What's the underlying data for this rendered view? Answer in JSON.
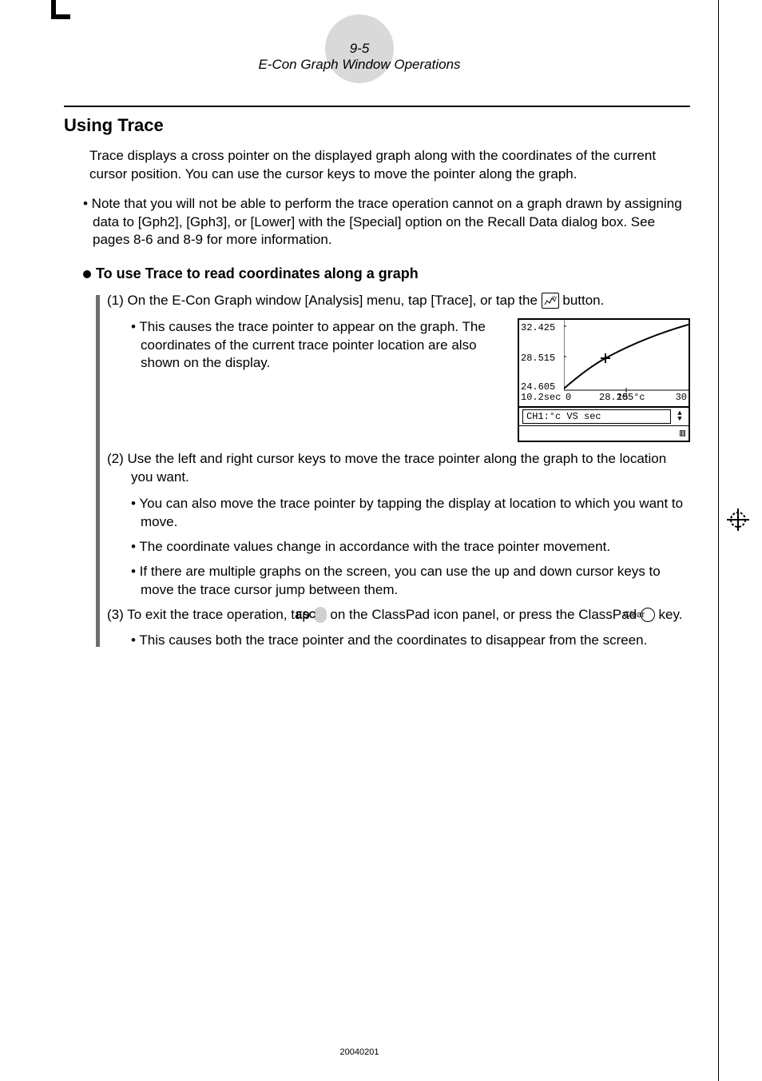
{
  "header": {
    "page_num": "9-5",
    "section_title": "E-Con Graph Window Operations"
  },
  "h2": "Using Trace",
  "intro": "Trace displays a cross pointer on the displayed graph along with the coordinates of the current cursor position. You can use the cursor keys to move the pointer along the graph.",
  "note": "• Note that you will not be able to perform the trace operation cannot on a graph drawn by assigning data to [Gph2], [Gph3], or [Lower] with the [Special] option on the Recall Data dialog box. See pages 8-6 and 8-9 for more information.",
  "sub_h": "To use Trace to read coordinates along a graph",
  "step1_prefix": "(1) On the E-Con Graph window [Analysis] menu, tap [Trace], or tap the ",
  "step1_suffix": " button.",
  "step1_bullet": "• This causes the trace pointer to appear on the graph. The coordinates of the current trace pointer location are also shown on the display.",
  "step2": "(2) Use the left and right cursor keys to move the trace pointer along the graph to the location you want.",
  "step2_b1": "• You can also move the trace pointer by tapping the display at location to which you want to move.",
  "step2_b2": "• The coordinate values change in accordance with the trace pointer movement.",
  "step2_b3": "• If there are multiple graphs on the screen, you can use the up and down cursor keys to move the trace cursor jump between them.",
  "step3_prefix": "(3) To exit the trace operation, tap ",
  "step3_mid": " on the ClassPad icon panel, or press the ClassPad ",
  "step3_suffix": " key.",
  "step3_b1": "• This causes both the trace pointer and the coordinates to disappear from the screen.",
  "icons": {
    "trace_btn": "⤳",
    "esc_label": "ESC",
    "clear_label": "Clear"
  },
  "figure": {
    "y_ticks": [
      "32.425",
      "28.515",
      "24.605"
    ],
    "x_ticks": [
      "0",
      "15",
      "30"
    ],
    "cursor_x": "10.2sec",
    "cursor_y": "28.205°c",
    "status": "CH1:°c VS sec",
    "battery": "▥"
  },
  "chart_data": {
    "type": "line",
    "title": "",
    "xlabel": "sec",
    "ylabel": "°c",
    "x": [
      0,
      5,
      10,
      15,
      20,
      25,
      30
    ],
    "values": [
      24.605,
      26.6,
      28.205,
      29.3,
      30.3,
      31.3,
      32.2
    ],
    "xlim": [
      0,
      30
    ],
    "ylim": [
      24.605,
      32.425
    ],
    "cursor": {
      "x": 10.2,
      "y": 28.205
    },
    "annotations": [
      "10.2sec",
      "28.205°c"
    ],
    "legend": "CH1:°c VS sec"
  },
  "footer_code": "20040201"
}
